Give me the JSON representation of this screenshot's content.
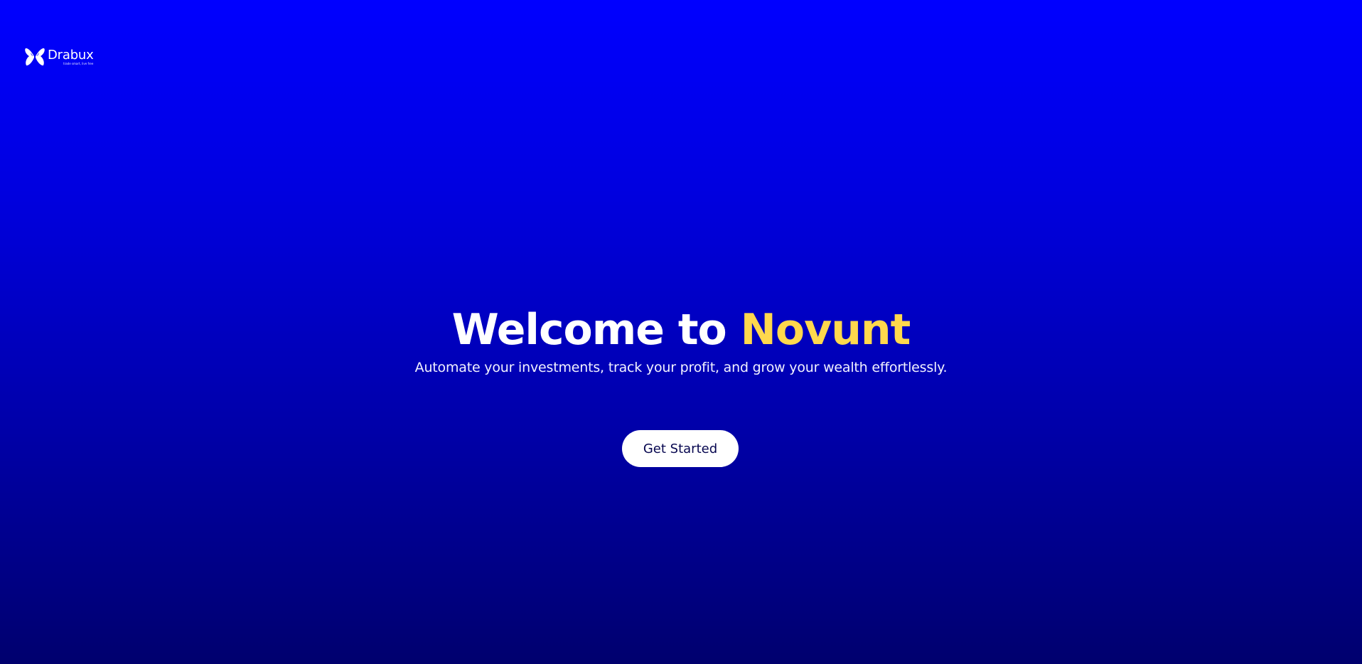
{
  "brand": {
    "logo_icon": "butterfly-logo-icon",
    "name": "Drabux",
    "tagline": "trade smart, live free"
  },
  "hero": {
    "headline_prefix": "Welcome to ",
    "headline_highlight": "Novunt",
    "subtitle": "Automate your investments, track your profit, and grow your wealth effortlessly."
  },
  "cta": {
    "label": "Get Started"
  },
  "colors": {
    "background_top": "#0000ff",
    "background_bottom": "#00006e",
    "accent": "#ffd84d",
    "button_bg": "#ffffff",
    "button_text": "#06064f"
  }
}
